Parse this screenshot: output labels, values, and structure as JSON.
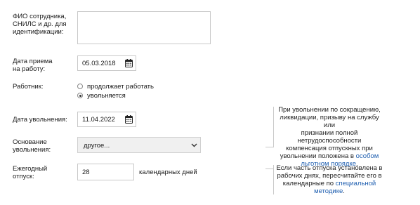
{
  "fields": {
    "id_label": [
      "ФИО сотрудника,",
      "СНИЛС и др. для",
      "идентификации:"
    ],
    "hire_label": [
      "Дата приема",
      "на работу:"
    ],
    "hire_date": "05.03.2018",
    "employee_label": "Работник:",
    "radio_options": [
      "продолжает работать",
      "увольняется"
    ],
    "radio_selected": 1,
    "dismissal_label": "Дата увольнения:",
    "dismissal_date": "11.04.2022",
    "reason_label": [
      "Основание",
      "увольнения:"
    ],
    "reason_value": "другое...",
    "leave_label": [
      "Ежегодный",
      "отпуск:"
    ],
    "leave_value": "28",
    "leave_unit": "календарных дней"
  },
  "notes": {
    "note1_lines": [
      "При увольнении по сокращению,",
      "ликвидации, призыву на службу или",
      "признании полной нетрудоспособности",
      "компенсация отпускных при",
      "увольнении положена в"
    ],
    "note1_link_a": "особом",
    "note1_link_b": "льготном порядке",
    "note1_end": ".",
    "note2_lines": [
      "Если часть отпуска установлена в",
      "рабочих днях, пересчитайте его в",
      "календарные по"
    ],
    "note2_link_a": "специальной",
    "note2_link_b": "методике",
    "note2_end": "."
  },
  "icons": {
    "calendar": "calendar-icon",
    "select_arrow": "chevron-down-icon"
  },
  "colors": {
    "link": "#1f5fb0",
    "border": "#c8c8c8"
  }
}
